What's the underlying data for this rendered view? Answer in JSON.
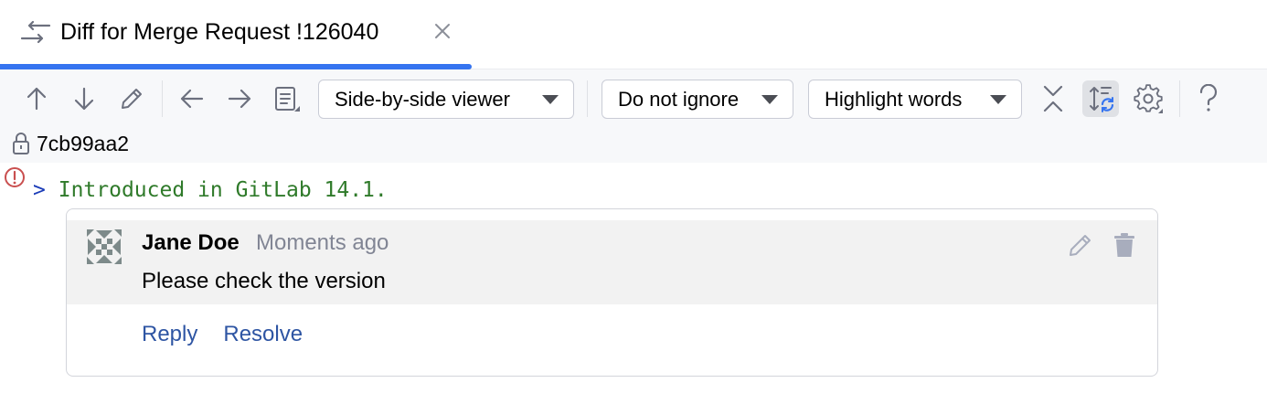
{
  "tab": {
    "title": "Diff for Merge Request !126040",
    "active_color": "#3574f0"
  },
  "toolbar": {
    "buttons": [
      {
        "name": "previous-difference",
        "icon": "arrow-up-icon"
      },
      {
        "name": "next-difference",
        "icon": "arrow-down-icon"
      },
      {
        "name": "edit-source",
        "icon": "pencil-icon"
      },
      {
        "name": "previous-file",
        "icon": "arrow-left-icon"
      },
      {
        "name": "next-file",
        "icon": "arrow-right-icon"
      },
      {
        "name": "file-list",
        "icon": "document-list-icon"
      },
      {
        "name": "collapse-unchanged",
        "icon": "collapse-icon"
      },
      {
        "name": "sync-scroll",
        "icon": "sync-scroll-icon"
      },
      {
        "name": "settings",
        "icon": "gear-icon"
      },
      {
        "name": "help",
        "icon": "question-icon"
      }
    ],
    "viewer_select": "Side-by-side viewer",
    "ignore_select": "Do not ignore",
    "highlight_select": "Highlight words"
  },
  "revision": {
    "hash": "7cb99aa2"
  },
  "diff": {
    "marker": ">",
    "line_text": "Introduced in GitLab 14.1."
  },
  "comment": {
    "author": "Jane Doe",
    "time": "Moments ago",
    "text": "Please check the version",
    "reply_label": "Reply",
    "resolve_label": "Resolve"
  },
  "colors": {
    "accent": "#3574f0",
    "link": "#2e55a3",
    "error": "#c94f4f",
    "code_green": "#2f7a2a",
    "code_blue": "#1b3cb8"
  }
}
